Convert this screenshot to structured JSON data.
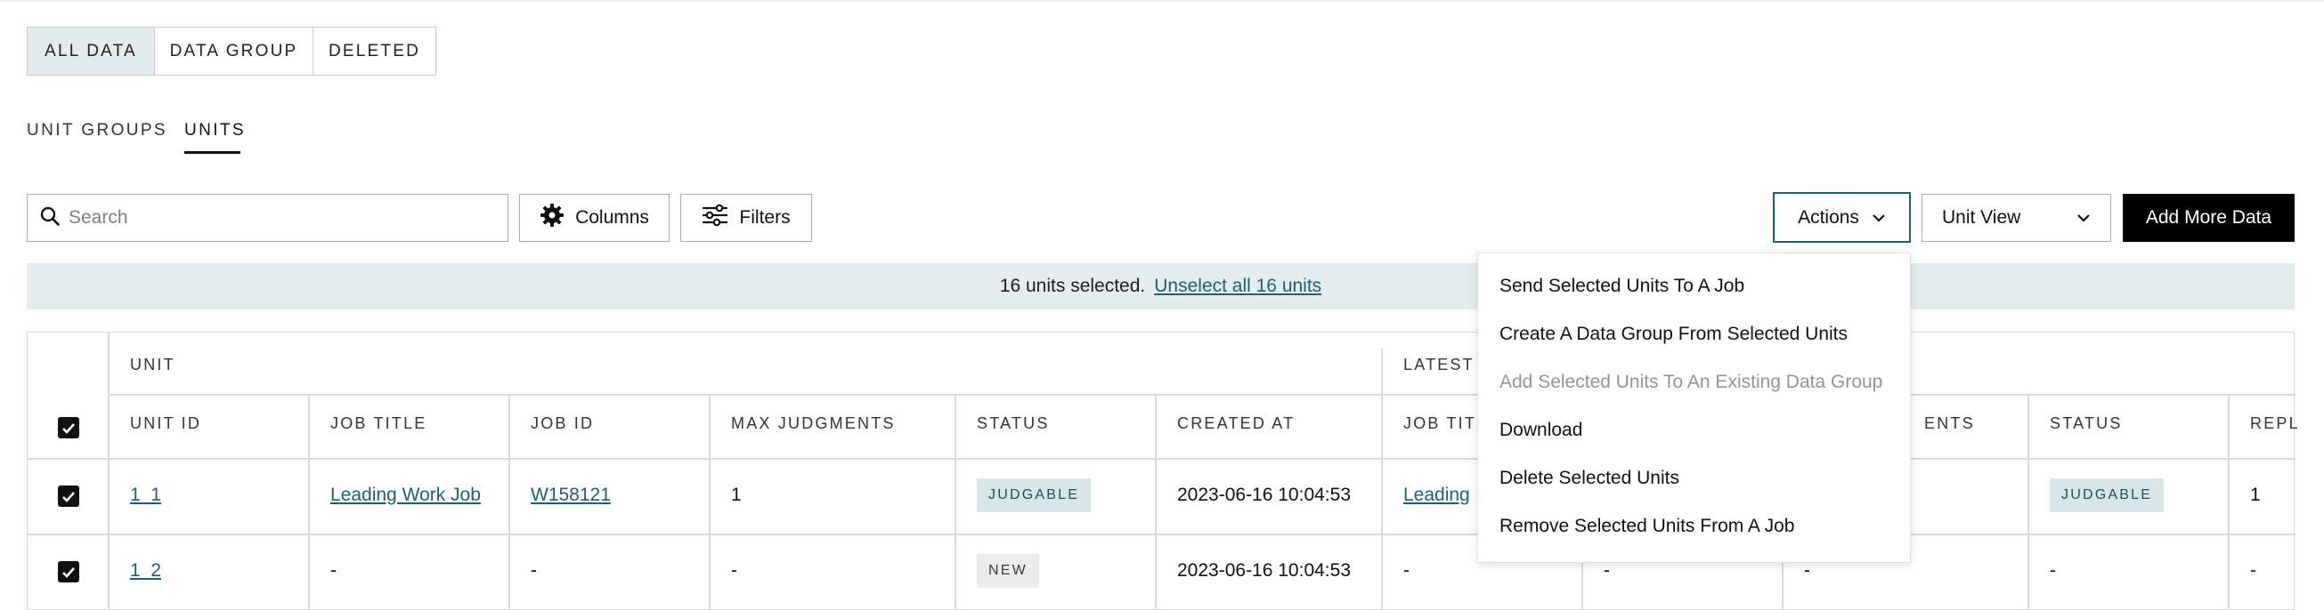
{
  "data_tabs": {
    "all_data": "ALL DATA",
    "data_group": "DATA GROUP",
    "deleted": "DELETED"
  },
  "sub_tabs": {
    "unit_groups": "UNIT GROUPS",
    "units": "UNITS"
  },
  "toolbar": {
    "search_placeholder": "Search",
    "columns_label": "Columns",
    "filters_label": "Filters",
    "actions_label": "Actions",
    "view_select": "Unit View",
    "add_more_label": "Add More Data"
  },
  "banner": {
    "text": "16 units selected.",
    "unselect_link": "Unselect all 16 units"
  },
  "table": {
    "groups": {
      "unit": "UNIT",
      "latest": "LATEST"
    },
    "headers": {
      "unit_id": "UNIT ID",
      "job_title": "JOB TITLE",
      "job_id": "JOB ID",
      "max_judgments": "MAX JUDGMENTS",
      "status": "STATUS",
      "created_at": "CREATED AT",
      "latest_job_title": "JOB TITL",
      "latest_judgments": "ENTS",
      "latest_status": "STATUS",
      "replies": "REPL"
    },
    "rows": [
      {
        "unit_id": "1_1",
        "job_title": "Leading Work Job",
        "job_id": "W158121",
        "max_judgments": "1",
        "status": "JUDGABLE",
        "created_at": "2023-06-16 10:04:53",
        "latest_job_title": "Leading",
        "latest_status": "JUDGABLE",
        "replies": "1"
      },
      {
        "unit_id": "1_2",
        "job_title": "-",
        "job_id": "-",
        "max_judgments": "-",
        "status": "NEW",
        "created_at": "2023-06-16 10:04:53",
        "latest_job_title": "-",
        "latest_job_id": "-",
        "latest_judgments": "-",
        "latest_status": "-",
        "replies": "-"
      }
    ]
  },
  "actions_menu": {
    "items": [
      "Send Selected Units To A Job",
      "Create A Data Group From Selected Units",
      "Add Selected Units To An Existing Data Group",
      "Download",
      "Delete Selected Units",
      "Remove Selected Units From A Job"
    ],
    "disabled_index": 2
  },
  "colors": {
    "accent": "#1e5f73",
    "banner_bg": "#e4ecee",
    "badge_bg": "#d9e6e9",
    "primary_button_bg": "#000000"
  }
}
